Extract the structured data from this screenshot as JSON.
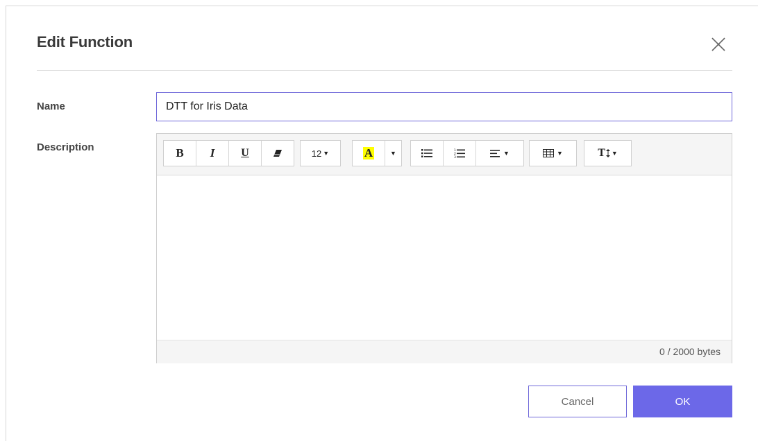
{
  "dialog": {
    "title": "Edit Function",
    "close_icon": "close-icon"
  },
  "form": {
    "name_label": "Name",
    "name_value": "DTT for Iris Data",
    "description_label": "Description"
  },
  "toolbar": {
    "bold_label": "B",
    "italic_label": "I",
    "underline_label": "U",
    "eraser_icon": "eraser-icon",
    "font_size_value": "12",
    "highlight_label": "A",
    "highlight_color": "#ffff00",
    "unordered_list_icon": "unordered-list-icon",
    "ordered_list_icon": "ordered-list-icon",
    "align_icon": "align-left-icon",
    "table_icon": "table-icon",
    "line_height_label": "T",
    "line_height_icon": "line-height-icon"
  },
  "editor": {
    "content": "",
    "byte_count": "0 / 2000 bytes"
  },
  "actions": {
    "cancel_label": "Cancel",
    "ok_label": "OK",
    "accent_color": "#6c68e8"
  }
}
